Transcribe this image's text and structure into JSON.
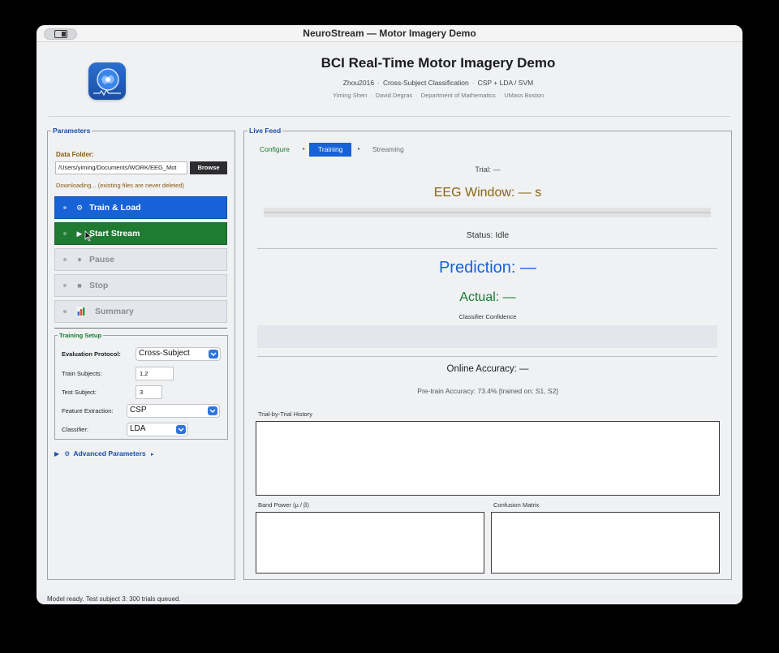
{
  "window": {
    "title": "NeuroStream — Motor Imagery Demo"
  },
  "header": {
    "logo_icon": "brain-wave-logo-icon",
    "title": "BCI  Real-Time Motor Imagery Demo",
    "sub": [
      "Zhou2016",
      "Cross-Subject Classification",
      "CSP + LDA / SVM"
    ],
    "authors": [
      "Yiming Shen",
      "David Degras",
      "Department of Mathematics",
      "UMass Boston"
    ]
  },
  "params": {
    "legend": "Parameters",
    "data_folder_label": "Data Folder:",
    "data_folder_value": "/Users/yiming/Documents/WORK/EEG_Mot",
    "browse_label": "Browse",
    "status_text": "Downloading...  (existing files are never deleted)",
    "buttons": {
      "train": {
        "icon": "⚙",
        "label": "Train & Load"
      },
      "start": {
        "icon": "▶",
        "label": "Start Stream"
      },
      "pause": {
        "icon": "⏸",
        "label": "Pause"
      },
      "stop": {
        "icon": "■",
        "label": "Stop"
      },
      "summary": {
        "icon": "chart-icon",
        "label": "Summary"
      }
    },
    "training_setup": {
      "legend": "Training Setup",
      "evaluation_protocol_label": "Evaluation Protocol:",
      "evaluation_protocol_value": "Cross-Subject",
      "train_subjects_label": "Train Subjects:",
      "train_subjects_value": "1,2",
      "test_subject_label": "Test Subject:",
      "test_subject_value": "3",
      "feature_extraction_label": "Feature Extraction:",
      "feature_extraction_value": "CSP",
      "classifier_label": "Classifier:",
      "classifier_value": "LDA"
    },
    "advanced": {
      "label": "Advanced Parameters",
      "arrow": "▸"
    }
  },
  "feed": {
    "legend": "Live Feed",
    "steps": [
      {
        "label": "Configure",
        "state": "done"
      },
      {
        "label": "Training",
        "state": "active"
      },
      {
        "label": "Streaming",
        "state": "todo"
      }
    ],
    "step_arrow": "▸",
    "trial_label": "Trial:  —",
    "eeg_window_label": "EEG Window:  — s",
    "status_label": "Status:  Idle",
    "prediction_label": "Prediction:  —",
    "actual_label": "Actual:  —",
    "confidence_label": "Classifier Confidence",
    "online_accuracy_label": "Online Accuracy:  —",
    "pretrain_accuracy_label": "Pre-train Accuracy:  73.4%   [trained on: S1, S2]",
    "history_label": "Trial-by-Trial History",
    "band_power_label": "Band Power  (μ / β)",
    "confusion_label": "Confusion Matrix"
  },
  "statusbar": {
    "text": "Model ready.  Test subject 3: 300 trials queued."
  },
  "colors": {
    "accent_blue": "#1662d6",
    "start_green": "#1f7a32",
    "warning_brown": "#8a5a10",
    "window_bg": "#eff1f3"
  }
}
